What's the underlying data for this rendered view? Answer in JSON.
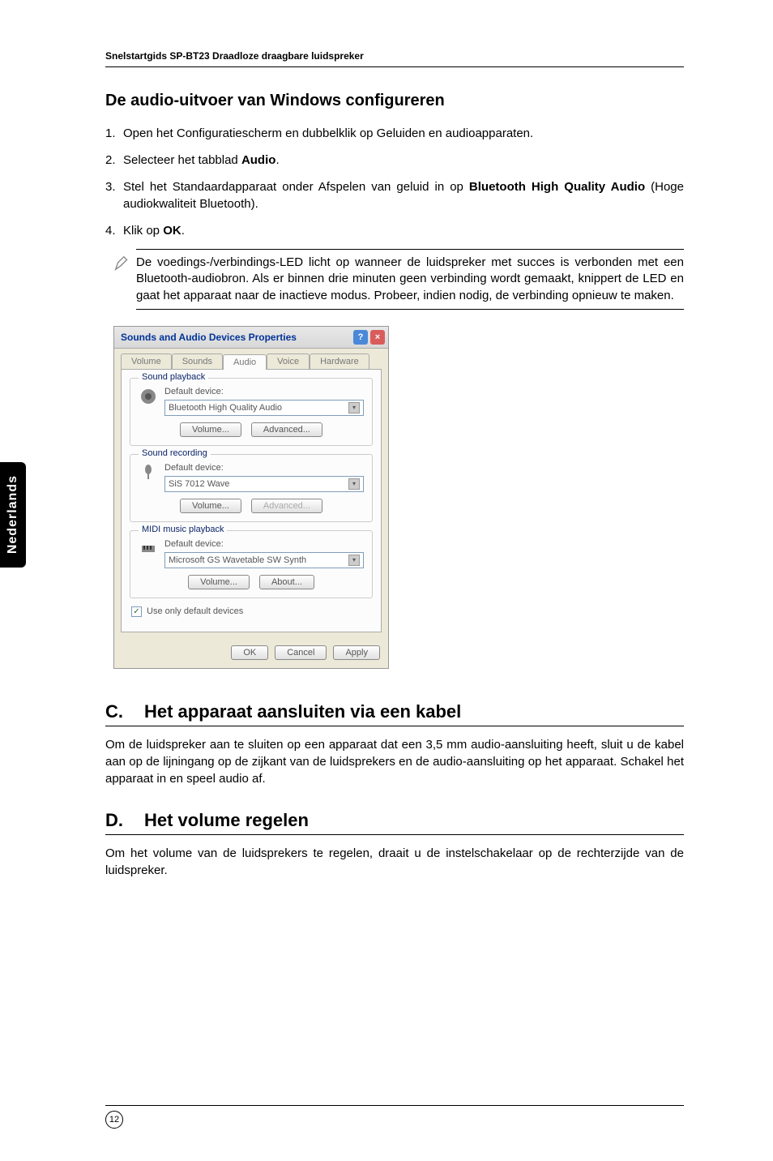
{
  "header": "Snelstartgids SP-BT23  Draadloze draagbare luidspreker",
  "section1_title": "De audio-uitvoer van Windows configureren",
  "steps": [
    {
      "num": "1.",
      "pre": "Open het Configuratiescherm en dubbelklik op Geluiden en audioapparaten."
    },
    {
      "num": "2.",
      "pre": "Selecteer het tabblad ",
      "bold": "Audio",
      "post": "."
    },
    {
      "num": "3.",
      "pre": "Stel het Standaardapparaat onder Afspelen van geluid in op ",
      "bold": "Bluetooth High Quality Audio",
      "post": " (Hoge audiokwaliteit Bluetooth)."
    },
    {
      "num": "4.",
      "pre": "Klik op ",
      "bold": "OK",
      "post": "."
    }
  ],
  "note": "De voedings-/verbindings-LED licht op wanneer de luidspreker met succes is verbonden met een Bluetooth-audiobron. Als er binnen drie minuten geen verbinding wordt gemaakt, knippert de LED en gaat het apparaat naar de inactieve modus. Probeer, indien nodig, de verbinding opnieuw te maken.",
  "dialog": {
    "title": "Sounds and Audio Devices Properties",
    "tabs": [
      "Volume",
      "Sounds",
      "Audio",
      "Voice",
      "Hardware"
    ],
    "active_tab": 2,
    "playback": {
      "legend": "Sound playback",
      "label": "Default device:",
      "value": "Bluetooth High Quality Audio",
      "btn1": "Volume...",
      "btn2": "Advanced..."
    },
    "recording": {
      "legend": "Sound recording",
      "label": "Default device:",
      "value": "SiS 7012 Wave",
      "btn1": "Volume...",
      "btn2": "Advanced..."
    },
    "midi": {
      "legend": "MIDI music playback",
      "label": "Default device:",
      "value": "Microsoft GS Wavetable SW Synth",
      "btn1": "Volume...",
      "btn2": "About..."
    },
    "checkbox": "Use only default devices",
    "ok": "OK",
    "cancel": "Cancel",
    "apply": "Apply"
  },
  "sectionC": {
    "letter": "C.",
    "title": "Het apparaat aansluiten via een kabel",
    "body": "Om de luidspreker aan te sluiten op een apparaat dat een 3,5 mm audio-aansluiting heeft, sluit u de kabel aan op de lijningang op de zijkant van de luidsprekers en de audio-aansluiting op het apparaat. Schakel het apparaat in en speel audio af."
  },
  "sectionD": {
    "letter": "D.",
    "title": "Het volume regelen",
    "body": "Om het volume van de luidsprekers te regelen, draait u de instelschakelaar op de rechterzijde van de luidspreker."
  },
  "side_tab": "Nederlands",
  "page_number": "12"
}
